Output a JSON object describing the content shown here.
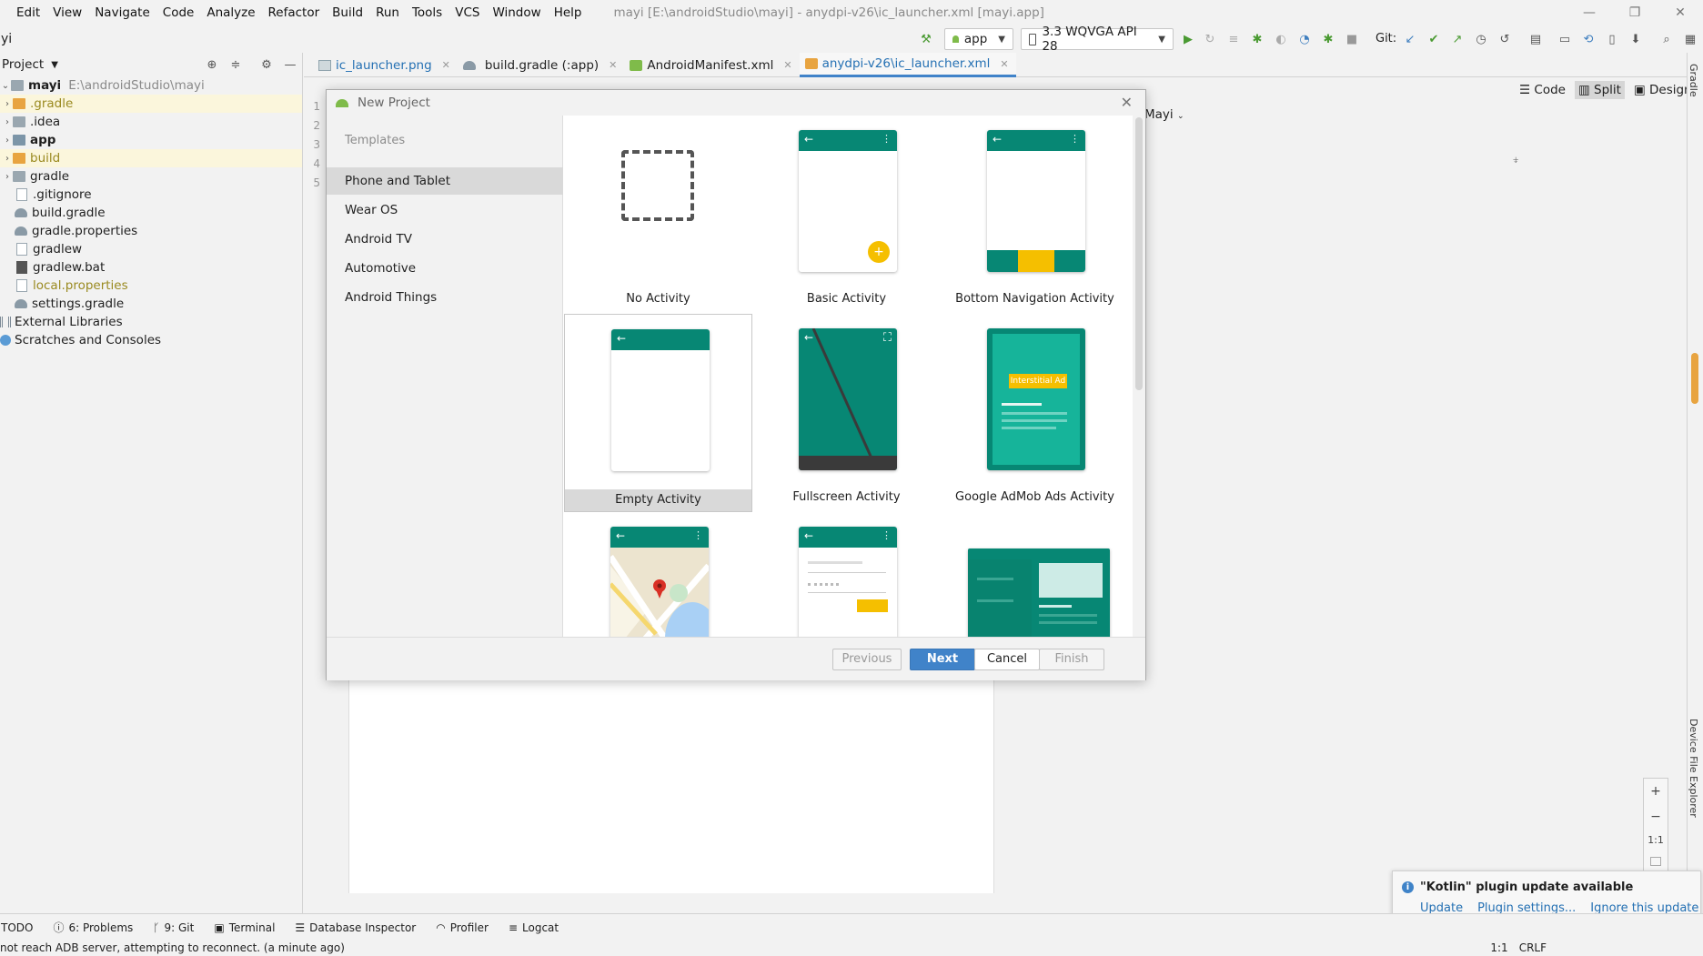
{
  "menubar": {
    "items": [
      "Edit",
      "View",
      "Navigate",
      "Code",
      "Analyze",
      "Refactor",
      "Build",
      "Run",
      "Tools",
      "VCS",
      "Window",
      "Help"
    ],
    "window_title": "mayi [E:\\androidStudio\\mayi] - anydpi-v26\\ic_launcher.xml [mayi.app]"
  },
  "toolbar": {
    "breadcrumb": "yi",
    "run_config": "app",
    "device": "3.3  WQVGA API 28",
    "git_label": "Git:"
  },
  "project": {
    "title": "Project",
    "tree": [
      {
        "name": "mayi",
        "path": "E:\\androidStudio\\mayi",
        "type": "root"
      },
      {
        "name": ".gradle",
        "type": "folder-orange"
      },
      {
        "name": ".idea",
        "type": "folder"
      },
      {
        "name": "app",
        "type": "folder"
      },
      {
        "name": "build",
        "type": "folder-orange"
      },
      {
        "name": "gradle",
        "type": "folder"
      },
      {
        "name": ".gitignore",
        "type": "file"
      },
      {
        "name": "build.gradle",
        "type": "gradle"
      },
      {
        "name": "gradle.properties",
        "type": "gradle"
      },
      {
        "name": "gradlew",
        "type": "file"
      },
      {
        "name": "gradlew.bat",
        "type": "file"
      },
      {
        "name": "local.properties",
        "type": "file"
      },
      {
        "name": "settings.gradle",
        "type": "gradle"
      },
      {
        "name": "External Libraries",
        "type": "lib"
      },
      {
        "name": "Scratches and Consoles",
        "type": "scratch"
      }
    ]
  },
  "tabs": [
    {
      "label": "ic_launcher.png"
    },
    {
      "label": "build.gradle (:app)"
    },
    {
      "label": "AndroidManifest.xml"
    },
    {
      "label": "anydpi-v26\\ic_launcher.xml"
    }
  ],
  "editor": {
    "line_numbers": [
      "1",
      "2",
      "3",
      "4",
      "5"
    ],
    "view_modes": [
      "Code",
      "Split",
      "Design"
    ],
    "mayi_label": "Mayi",
    "zoom": [
      "+",
      "−",
      "1:1"
    ]
  },
  "dialog": {
    "title": "New Project",
    "templates_header": "Templates",
    "categories": [
      "Phone and Tablet",
      "Wear OS",
      "Android TV",
      "Automotive",
      "Android Things"
    ],
    "templates": [
      "No Activity",
      "Basic Activity",
      "Bottom Navigation Activity",
      "Empty Activity",
      "Fullscreen Activity",
      "Google AdMob Ads Activity"
    ],
    "admob_badge": "Interstitial Ad",
    "buttons": {
      "previous": "Previous",
      "next": "Next",
      "cancel": "Cancel",
      "finish": "Finish"
    }
  },
  "right_stripe": {
    "gradle": "Gradle",
    "device_file_explorer": "Device File Explorer"
  },
  "bottombar": {
    "items": [
      "TODO",
      "6: Problems",
      "9: Git",
      "Terminal",
      "Database Inspector",
      "Profiler",
      "Logcat"
    ]
  },
  "status": {
    "message": "not reach ADB server, attempting to reconnect. (a minute ago)",
    "position": "1:1",
    "line_sep": "CRLF"
  },
  "notification": {
    "title": "\"Kotlin\" plugin update available",
    "links": [
      "Update",
      "Plugin settings...",
      "Ignore this update"
    ]
  },
  "colors": {
    "teal": "#078774",
    "accent_blue": "#4083c9",
    "amber": "#f5bf00"
  }
}
